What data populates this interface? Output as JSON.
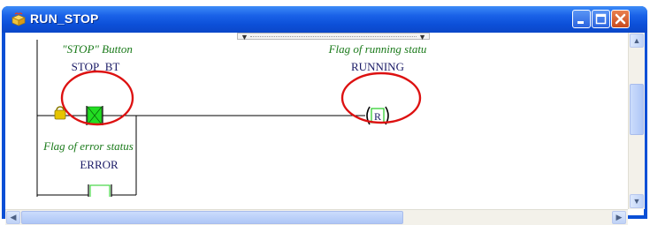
{
  "window": {
    "title": "RUN_STOP"
  },
  "ladder": {
    "rung1": {
      "contact_comment": "\"STOP\" Button",
      "contact_name": "STOP_BT",
      "coil_comment": "Flag of running statu",
      "coil_name": "RUNNING",
      "coil_type": "R"
    },
    "rung2": {
      "contact_comment": "Flag of error status",
      "contact_name": "ERROR"
    }
  },
  "icons": {
    "app": "package-icon",
    "lock": "lock-icon",
    "minimize": "minimize-icon",
    "maximize": "maximize-icon",
    "close": "close-icon"
  },
  "colors": {
    "titlebar": "#0c4fd8",
    "comment_text": "#1a7a1a",
    "variable_text": "#1a1a66",
    "contact_on": "#22dd22",
    "highlight_circle": "#dd1111",
    "lock": "#d8b800"
  }
}
